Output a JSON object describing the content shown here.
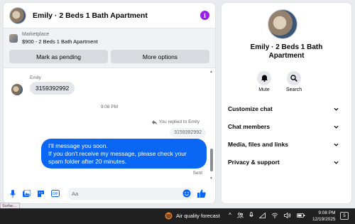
{
  "chat": {
    "title": "Emily · 2 Beds 1 Bath Apartment",
    "info_icon": "info-icon",
    "listing": {
      "kind": "Marketplace",
      "summary": "$900 - 2 Beds 1 Bath Apartment",
      "mark_pending": "Mark as pending",
      "more_options": "More options"
    },
    "messages": {
      "sender_name": "Emily",
      "incoming_text": "3159392992",
      "timestamp": "9:08 PM",
      "replied_label": "You replied to Emily",
      "quoted_text": "3159392992",
      "outgoing_lines": [
        "I'll message you soon.",
        "If you don't receive my message, please check your spam folder after 20 minutes."
      ],
      "status": "Sent"
    },
    "composer": {
      "placeholder": "Aa",
      "icons": [
        "microphone-icon",
        "photo-icon",
        "sticker-icon",
        "gif-icon",
        "emoji-icon",
        "like-icon"
      ]
    }
  },
  "info_panel": {
    "name": "Emily · 2 Beds 1 Bath Apartment",
    "actions": [
      {
        "label": "Mute",
        "icon": "bell-icon"
      },
      {
        "label": "Search",
        "icon": "search-icon"
      }
    ],
    "sections": [
      "Customize chat",
      "Chat members",
      "Media, files and links",
      "Privacy & support"
    ]
  },
  "taskbar": {
    "surface_tag": "Surfac...",
    "weather": "Air quality forecast",
    "time": "9:08 PM",
    "date": "12/19/2025",
    "notification_count": "5"
  },
  "colors": {
    "accent": "#0866ff",
    "outgoing_bubble": "#0a66f5",
    "incoming_bubble": "#e4e6eb",
    "info_badge": "#9b1fe8",
    "taskbar": "#202020"
  }
}
